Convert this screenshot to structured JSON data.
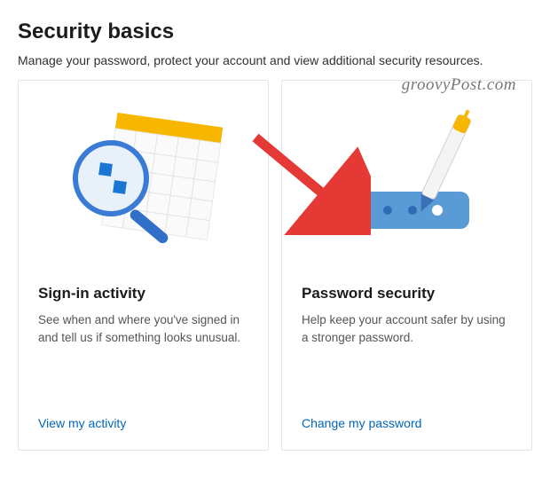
{
  "header": {
    "title": "Security basics",
    "subtitle": "Manage your password, protect your account and view additional security resources."
  },
  "watermark": "groovyPost.com",
  "cards": [
    {
      "title": "Sign-in activity",
      "description": "See when and where you've signed in and tell us if something looks unusual.",
      "link_label": "View my activity"
    },
    {
      "title": "Password security",
      "description": "Help keep your account safer by using a stronger password.",
      "link_label": "Change my password"
    }
  ]
}
